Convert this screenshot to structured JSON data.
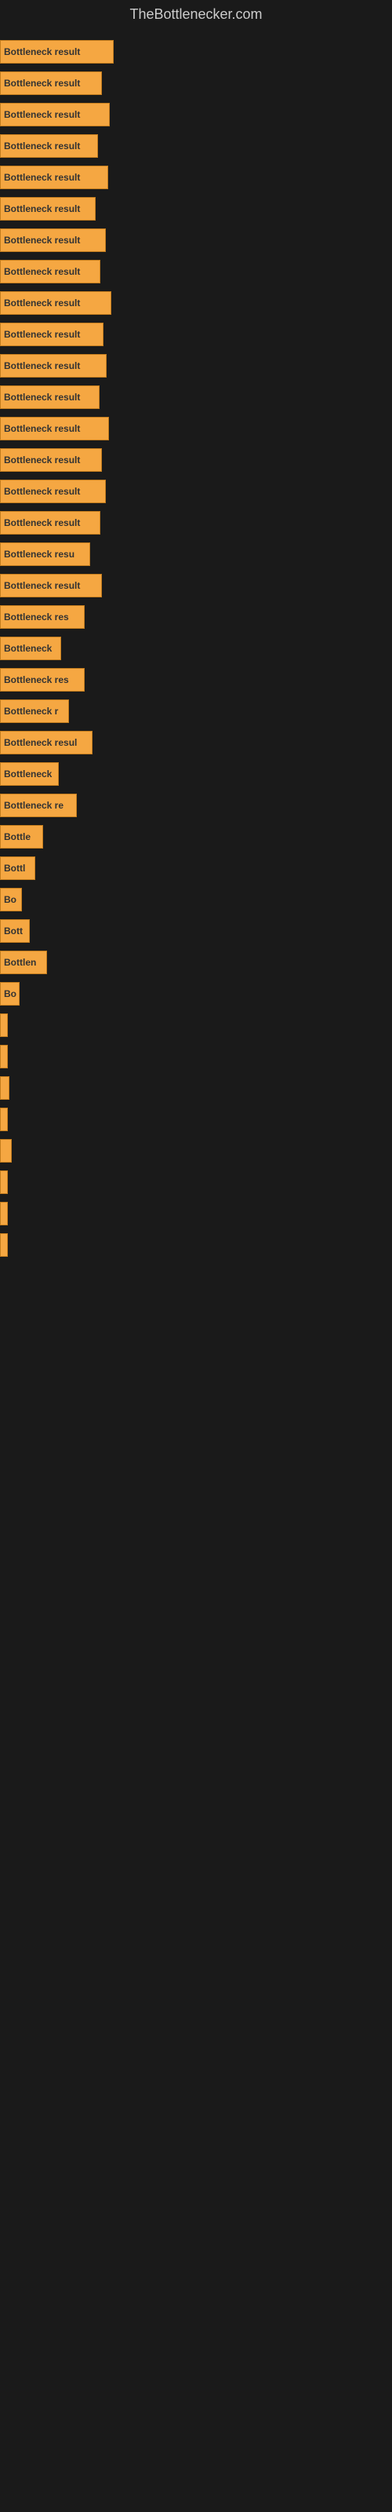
{
  "site": {
    "title": "TheBottlenecker.com"
  },
  "bars": [
    {
      "label": "Bottleneck result",
      "width": 145
    },
    {
      "label": "Bottleneck result",
      "width": 130
    },
    {
      "label": "Bottleneck result",
      "width": 140
    },
    {
      "label": "Bottleneck result",
      "width": 125
    },
    {
      "label": "Bottleneck result",
      "width": 138
    },
    {
      "label": "Bottleneck result",
      "width": 122
    },
    {
      "label": "Bottleneck result",
      "width": 135
    },
    {
      "label": "Bottleneck result",
      "width": 128
    },
    {
      "label": "Bottleneck result",
      "width": 142
    },
    {
      "label": "Bottleneck result",
      "width": 132
    },
    {
      "label": "Bottleneck result",
      "width": 136
    },
    {
      "label": "Bottleneck result",
      "width": 127
    },
    {
      "label": "Bottleneck result",
      "width": 139
    },
    {
      "label": "Bottleneck result",
      "width": 130
    },
    {
      "label": "Bottleneck result",
      "width": 135
    },
    {
      "label": "Bottleneck result",
      "width": 128
    },
    {
      "label": "Bottleneck resu",
      "width": 115
    },
    {
      "label": "Bottleneck result",
      "width": 130
    },
    {
      "label": "Bottleneck res",
      "width": 108
    },
    {
      "label": "Bottleneck",
      "width": 78
    },
    {
      "label": "Bottleneck res",
      "width": 108
    },
    {
      "label": "Bottleneck r",
      "width": 88
    },
    {
      "label": "Bottleneck resul",
      "width": 118
    },
    {
      "label": "Bottleneck",
      "width": 75
    },
    {
      "label": "Bottleneck re",
      "width": 98
    },
    {
      "label": "Bottle",
      "width": 55
    },
    {
      "label": "Bottl",
      "width": 45
    },
    {
      "label": "Bo",
      "width": 28
    },
    {
      "label": "Bott",
      "width": 38
    },
    {
      "label": "Bottlen",
      "width": 60
    },
    {
      "label": "Bo",
      "width": 25
    },
    {
      "label": "",
      "width": 8
    },
    {
      "label": "",
      "width": 4
    },
    {
      "label": "",
      "width": 12
    },
    {
      "label": "",
      "width": 6
    },
    {
      "label": "",
      "width": 15
    },
    {
      "label": "",
      "width": 10
    },
    {
      "label": "",
      "width": 8
    },
    {
      "label": "",
      "width": 5
    }
  ]
}
